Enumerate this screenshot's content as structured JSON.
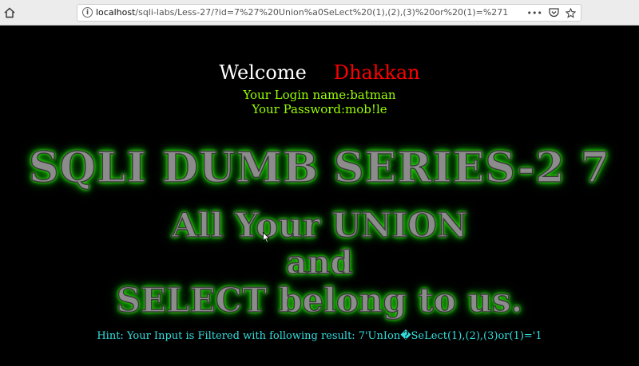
{
  "browser": {
    "url_scheme_host": "localhost",
    "url_rest": "/sqli-labs/Less-27/?id=7%27%20Union%a0SeLect%20(1),(2),(3)%20or%20(1)=%271",
    "more_label": "•••"
  },
  "page": {
    "welcome": "Welcome",
    "user_name": "Dhakkan",
    "login_line": "Your Login name:batman",
    "password_line": "Your Password:mob!le",
    "title": "SQLI DUMB SERIES-2 7",
    "subtitle_1": "All Your UNION",
    "subtitle_2": "and",
    "subtitle_3": "SELECT belong to us.",
    "hint_label": "Hint: Your Input is Filtered with following result:",
    "hint_value": "7'UnIon�SeLect(1),(2),(3)or(1)='1"
  },
  "colors": {
    "background": "#000000",
    "welcome": "#ffffff",
    "user_name": "#ff0000",
    "credentials": "#99ff00",
    "banner_glow": "#33ff00",
    "hint": "#33dddd"
  }
}
